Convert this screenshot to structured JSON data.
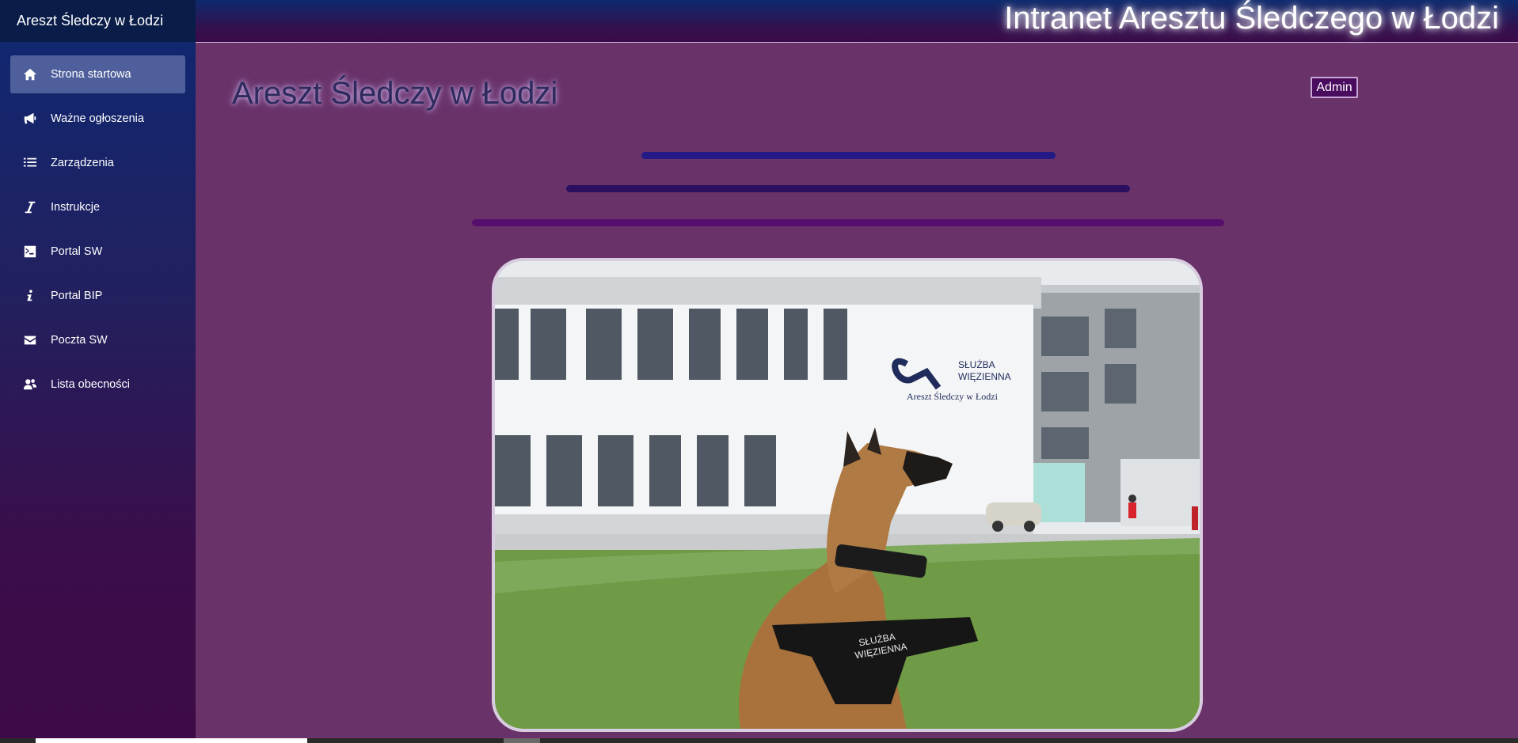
{
  "sidebar": {
    "brand": "Areszt Śledczy w Łodzi",
    "items": [
      {
        "label": "Strona startowa",
        "icon": "home-icon",
        "active": true
      },
      {
        "label": "Ważne ogłoszenia",
        "icon": "megaphone-icon",
        "active": false
      },
      {
        "label": "Zarządzenia",
        "icon": "list-icon",
        "active": false
      },
      {
        "label": "Instrukcje",
        "icon": "italic-icon",
        "active": false
      },
      {
        "label": "Portal SW",
        "icon": "terminal-icon",
        "active": false
      },
      {
        "label": "Portal BIP",
        "icon": "info-icon",
        "active": false
      },
      {
        "label": "Poczta SW",
        "icon": "envelope-icon",
        "active": false
      },
      {
        "label": "Lista obecności",
        "icon": "users-icon",
        "active": false
      }
    ]
  },
  "header": {
    "title": "Intranet Aresztu Śledczego w Łodzi"
  },
  "main": {
    "title": "Areszt Śledczy w Łodzi",
    "admin_label": "Admin",
    "photo": {
      "sign_line1": "SŁUŻBA",
      "sign_line2": "WIĘZIENNA",
      "sign_name": "Areszt Śledczy w Łodzi",
      "harness_line1": "SŁUŻBA",
      "harness_line2": "WIĘZIENNA"
    }
  },
  "colors": {
    "sidebar_active": "#4f5f9c",
    "content_bg": "#693269",
    "bar_1": "#241a86",
    "bar_2": "#2c0f5e",
    "bar_3": "#560f6c"
  }
}
